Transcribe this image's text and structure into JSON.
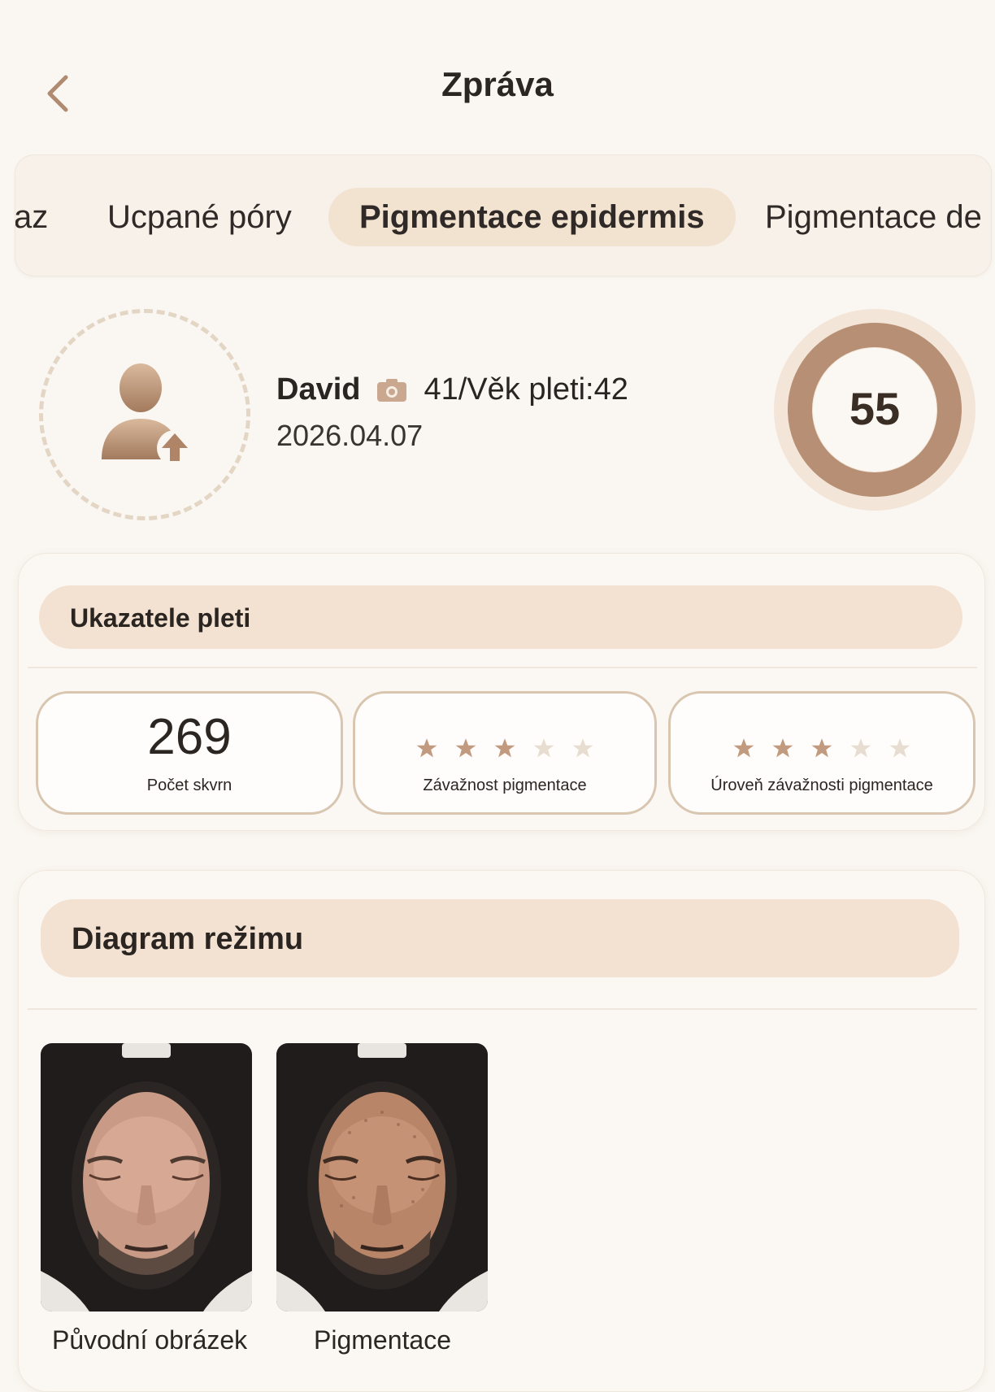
{
  "header": {
    "title": "Zpráva",
    "back_icon": "chevron-left-icon"
  },
  "tabs": [
    {
      "label": "az",
      "active": false
    },
    {
      "label": "Ucpané póry",
      "active": false
    },
    {
      "label": "Pigmentace epidermis",
      "active": true
    },
    {
      "label": "Pigmentace de",
      "active": false
    }
  ],
  "profile": {
    "name": "David",
    "age_text": "41/Věk pleti:42",
    "date": "2026.04.07",
    "camera_icon": "camera-icon",
    "avatar_icon": "user-upload-icon",
    "score": "55"
  },
  "indicators": {
    "title": "Ukazatele pleti",
    "metrics": [
      {
        "value": "269",
        "label": "Počet skvrn"
      },
      {
        "label": "Závažnost pigmentace",
        "stars": 3,
        "max_stars": 5
      },
      {
        "label": "Úroveň závažnosti pigmentace",
        "stars": 3,
        "max_stars": 5
      }
    ]
  },
  "diagram": {
    "title": "Diagram režimu",
    "images": [
      {
        "caption": "Původní obrázek"
      },
      {
        "caption": "Pigmentace"
      }
    ]
  },
  "colors": {
    "background": "#faf6f1",
    "accent": "#bd957a",
    "accent_light": "#f3e2d1",
    "star_on": "#c29a7f",
    "star_off": "#e8ddd1"
  }
}
